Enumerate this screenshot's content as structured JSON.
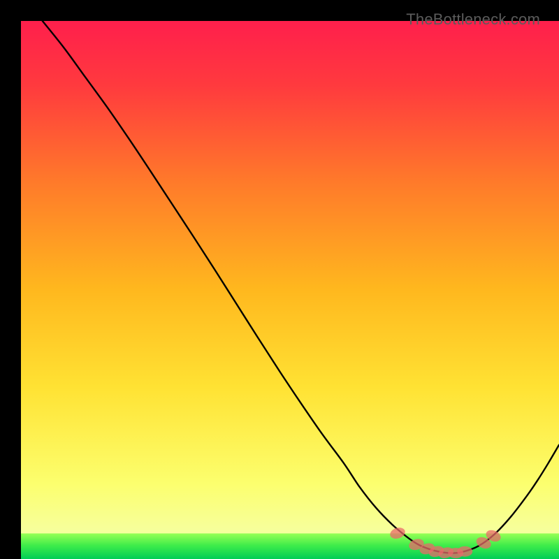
{
  "watermark": "TheBottleneck.com",
  "chart_data": {
    "type": "line",
    "title": "",
    "xlabel": "",
    "ylabel": "",
    "xlim": [
      0,
      100
    ],
    "ylim": [
      0,
      100
    ],
    "grid": false,
    "legend": false,
    "background_gradient": {
      "top": "#ff1f4c",
      "mid": "#ffd300",
      "bottom_band": "#fbff84",
      "green_band_top": "#7dff4a",
      "green_band_bottom": "#00d65a"
    },
    "series": [
      {
        "name": "bottleneck-curve",
        "color": "#000000",
        "x": [
          4,
          8,
          12,
          16,
          20,
          24,
          28,
          32,
          36,
          40,
          44,
          48,
          52,
          56,
          60,
          63,
          66,
          69,
          72,
          74,
          76,
          78,
          80,
          82,
          85,
          88,
          91,
          94,
          96,
          98,
          100
        ],
        "y": [
          100,
          95,
          89.5,
          84,
          78.2,
          72.2,
          66.1,
          60,
          53.8,
          47.5,
          41.2,
          35,
          29,
          23.2,
          17.8,
          13.3,
          9.5,
          6.4,
          3.9,
          2.6,
          1.8,
          1.3,
          1.1,
          1.3,
          2.4,
          4.6,
          7.8,
          11.7,
          14.6,
          17.8,
          21.2
        ]
      }
    ],
    "markers": {
      "name": "highlighted-points",
      "color": "#e96a6a",
      "opacity": 0.75,
      "points": [
        {
          "x": 70.0,
          "y": 4.8
        },
        {
          "x": 73.5,
          "y": 2.7
        },
        {
          "x": 75.5,
          "y": 1.9
        },
        {
          "x": 77.2,
          "y": 1.4
        },
        {
          "x": 79.0,
          "y": 1.15
        },
        {
          "x": 80.8,
          "y": 1.1
        },
        {
          "x": 82.5,
          "y": 1.4
        },
        {
          "x": 86.0,
          "y": 3.0
        },
        {
          "x": 87.8,
          "y": 4.3
        }
      ]
    }
  }
}
